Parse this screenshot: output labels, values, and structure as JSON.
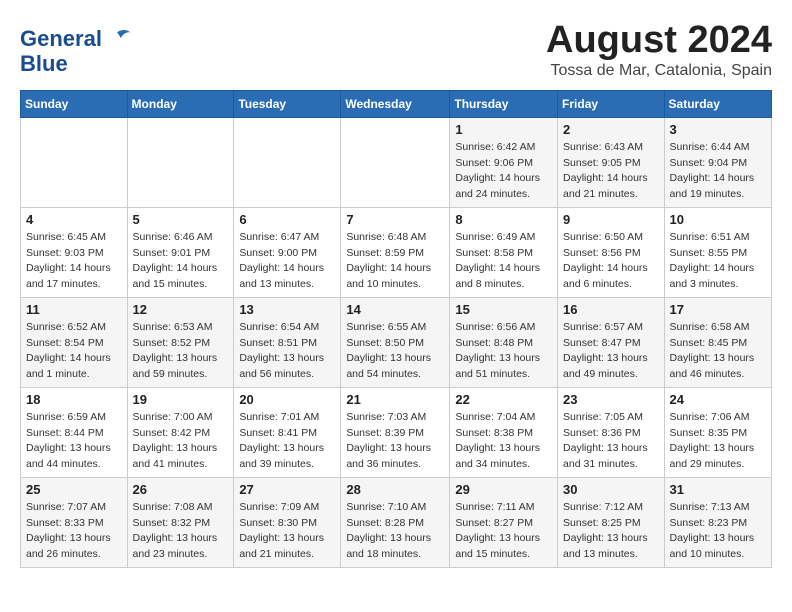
{
  "logo": {
    "line1": "General",
    "line2": "Blue"
  },
  "title": "August 2024",
  "location": "Tossa de Mar, Catalonia, Spain",
  "days_of_week": [
    "Sunday",
    "Monday",
    "Tuesday",
    "Wednesday",
    "Thursday",
    "Friday",
    "Saturday"
  ],
  "weeks": [
    [
      {
        "day": "",
        "info": ""
      },
      {
        "day": "",
        "info": ""
      },
      {
        "day": "",
        "info": ""
      },
      {
        "day": "",
        "info": ""
      },
      {
        "day": "1",
        "info": "Sunrise: 6:42 AM\nSunset: 9:06 PM\nDaylight: 14 hours and 24 minutes."
      },
      {
        "day": "2",
        "info": "Sunrise: 6:43 AM\nSunset: 9:05 PM\nDaylight: 14 hours and 21 minutes."
      },
      {
        "day": "3",
        "info": "Sunrise: 6:44 AM\nSunset: 9:04 PM\nDaylight: 14 hours and 19 minutes."
      }
    ],
    [
      {
        "day": "4",
        "info": "Sunrise: 6:45 AM\nSunset: 9:03 PM\nDaylight: 14 hours and 17 minutes."
      },
      {
        "day": "5",
        "info": "Sunrise: 6:46 AM\nSunset: 9:01 PM\nDaylight: 14 hours and 15 minutes."
      },
      {
        "day": "6",
        "info": "Sunrise: 6:47 AM\nSunset: 9:00 PM\nDaylight: 14 hours and 13 minutes."
      },
      {
        "day": "7",
        "info": "Sunrise: 6:48 AM\nSunset: 8:59 PM\nDaylight: 14 hours and 10 minutes."
      },
      {
        "day": "8",
        "info": "Sunrise: 6:49 AM\nSunset: 8:58 PM\nDaylight: 14 hours and 8 minutes."
      },
      {
        "day": "9",
        "info": "Sunrise: 6:50 AM\nSunset: 8:56 PM\nDaylight: 14 hours and 6 minutes."
      },
      {
        "day": "10",
        "info": "Sunrise: 6:51 AM\nSunset: 8:55 PM\nDaylight: 14 hours and 3 minutes."
      }
    ],
    [
      {
        "day": "11",
        "info": "Sunrise: 6:52 AM\nSunset: 8:54 PM\nDaylight: 14 hours and 1 minute."
      },
      {
        "day": "12",
        "info": "Sunrise: 6:53 AM\nSunset: 8:52 PM\nDaylight: 13 hours and 59 minutes."
      },
      {
        "day": "13",
        "info": "Sunrise: 6:54 AM\nSunset: 8:51 PM\nDaylight: 13 hours and 56 minutes."
      },
      {
        "day": "14",
        "info": "Sunrise: 6:55 AM\nSunset: 8:50 PM\nDaylight: 13 hours and 54 minutes."
      },
      {
        "day": "15",
        "info": "Sunrise: 6:56 AM\nSunset: 8:48 PM\nDaylight: 13 hours and 51 minutes."
      },
      {
        "day": "16",
        "info": "Sunrise: 6:57 AM\nSunset: 8:47 PM\nDaylight: 13 hours and 49 minutes."
      },
      {
        "day": "17",
        "info": "Sunrise: 6:58 AM\nSunset: 8:45 PM\nDaylight: 13 hours and 46 minutes."
      }
    ],
    [
      {
        "day": "18",
        "info": "Sunrise: 6:59 AM\nSunset: 8:44 PM\nDaylight: 13 hours and 44 minutes."
      },
      {
        "day": "19",
        "info": "Sunrise: 7:00 AM\nSunset: 8:42 PM\nDaylight: 13 hours and 41 minutes."
      },
      {
        "day": "20",
        "info": "Sunrise: 7:01 AM\nSunset: 8:41 PM\nDaylight: 13 hours and 39 minutes."
      },
      {
        "day": "21",
        "info": "Sunrise: 7:03 AM\nSunset: 8:39 PM\nDaylight: 13 hours and 36 minutes."
      },
      {
        "day": "22",
        "info": "Sunrise: 7:04 AM\nSunset: 8:38 PM\nDaylight: 13 hours and 34 minutes."
      },
      {
        "day": "23",
        "info": "Sunrise: 7:05 AM\nSunset: 8:36 PM\nDaylight: 13 hours and 31 minutes."
      },
      {
        "day": "24",
        "info": "Sunrise: 7:06 AM\nSunset: 8:35 PM\nDaylight: 13 hours and 29 minutes."
      }
    ],
    [
      {
        "day": "25",
        "info": "Sunrise: 7:07 AM\nSunset: 8:33 PM\nDaylight: 13 hours and 26 minutes."
      },
      {
        "day": "26",
        "info": "Sunrise: 7:08 AM\nSunset: 8:32 PM\nDaylight: 13 hours and 23 minutes."
      },
      {
        "day": "27",
        "info": "Sunrise: 7:09 AM\nSunset: 8:30 PM\nDaylight: 13 hours and 21 minutes."
      },
      {
        "day": "28",
        "info": "Sunrise: 7:10 AM\nSunset: 8:28 PM\nDaylight: 13 hours and 18 minutes."
      },
      {
        "day": "29",
        "info": "Sunrise: 7:11 AM\nSunset: 8:27 PM\nDaylight: 13 hours and 15 minutes."
      },
      {
        "day": "30",
        "info": "Sunrise: 7:12 AM\nSunset: 8:25 PM\nDaylight: 13 hours and 13 minutes."
      },
      {
        "day": "31",
        "info": "Sunrise: 7:13 AM\nSunset: 8:23 PM\nDaylight: 13 hours and 10 minutes."
      }
    ]
  ]
}
